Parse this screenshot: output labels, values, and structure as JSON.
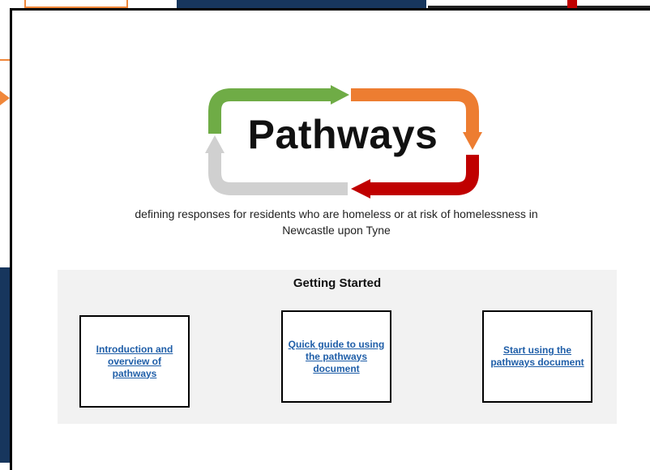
{
  "logo": {
    "title": "Pathways",
    "colors": {
      "green": "#6fac46",
      "orange": "#ed7d31",
      "red": "#c00000",
      "grey": "#d0d0d0"
    }
  },
  "subtitle": {
    "line1": "defining responses for residents who are homeless or at risk of homelessness in",
    "line2": "Newcastle upon Tyne"
  },
  "getting_started": {
    "title": "Getting Started",
    "links": [
      {
        "label": "Introduction and overview of pathways"
      },
      {
        "label": "Quick guide to using the pathways document"
      },
      {
        "label": "Start using the pathways document"
      }
    ]
  },
  "colors": {
    "link": "#1f5ea8",
    "panel": "#f2f2f2",
    "navy": "#17365d"
  }
}
